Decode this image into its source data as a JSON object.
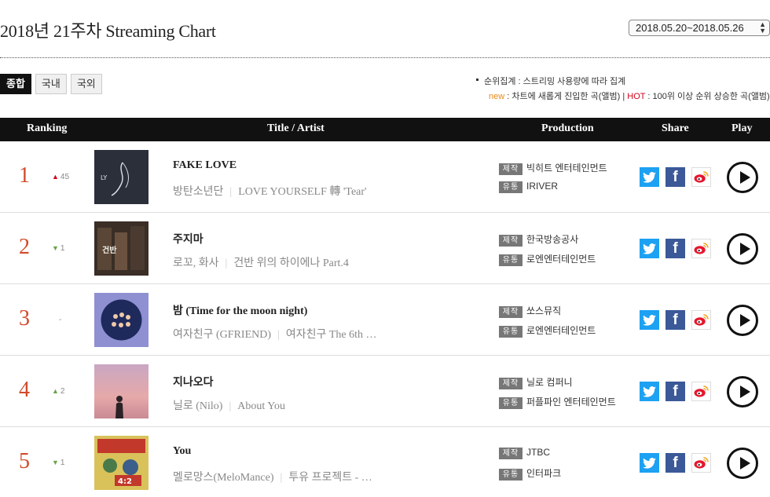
{
  "page": {
    "title": "2018년 21주차 Streaming Chart",
    "date_range": "2018.05.20~2018.05.26"
  },
  "tabs": [
    {
      "label": "종합",
      "active": true
    },
    {
      "label": "국내",
      "active": false
    },
    {
      "label": "국외",
      "active": false
    }
  ],
  "notes": {
    "line1": "순위집계 : 스트리밍 사용량에 따라 집계",
    "new_label": "new",
    "new_text": " : 차트에 새롭게 진입한 곡(앨범) | ",
    "hot_label": "HOT",
    "hot_text": " : 100위 이상 순위 상승한 곡(앨범)"
  },
  "header": {
    "ranking": "Ranking",
    "title_artist": "Title / Artist",
    "production": "Production",
    "share": "Share",
    "play": "Play"
  },
  "labels": {
    "produce": "제작",
    "distribute": "유통"
  },
  "colors": {
    "rank": "#d14a2b",
    "header_bg": "#111111",
    "up": "#d0021b",
    "down": "#6aa34a",
    "twitter": "#1da1f2",
    "facebook": "#3b5998"
  },
  "rows": [
    {
      "rank": "1",
      "change_dir": "up",
      "change": "45",
      "title": "FAKE LOVE",
      "artist": "방탄소년단",
      "album": "LOVE YOURSELF 轉 'Tear'",
      "producer": "빅히트 엔터테인먼트",
      "distributor": "IRIVER"
    },
    {
      "rank": "2",
      "change_dir": "down",
      "change": "1",
      "title": "주지마",
      "artist": "로꼬, 화사",
      "album": "건반 위의 하이에나 Part.4",
      "producer": "한국방송공사",
      "distributor": "로엔엔터테인먼트"
    },
    {
      "rank": "3",
      "change_dir": "same",
      "change": "-",
      "title": "밤 (Time for the moon night)",
      "artist": "여자친구 (GFRIEND)",
      "album": "여자친구 The 6th …",
      "producer": "쏘스뮤직",
      "distributor": "로엔엔터테인먼트"
    },
    {
      "rank": "4",
      "change_dir": "up",
      "change": "2",
      "title": "지나오다",
      "artist": "닐로 (Nilo)",
      "album": "About You",
      "producer": "닐로 컴퍼니",
      "distributor": "퍼플파인 엔터테인먼트"
    },
    {
      "rank": "5",
      "change_dir": "down",
      "change": "1",
      "title": "You",
      "artist": "멜로망스(MeloMance)",
      "album": "투유 프로젝트 - …",
      "producer": "JTBC",
      "distributor": "인터파크"
    }
  ]
}
